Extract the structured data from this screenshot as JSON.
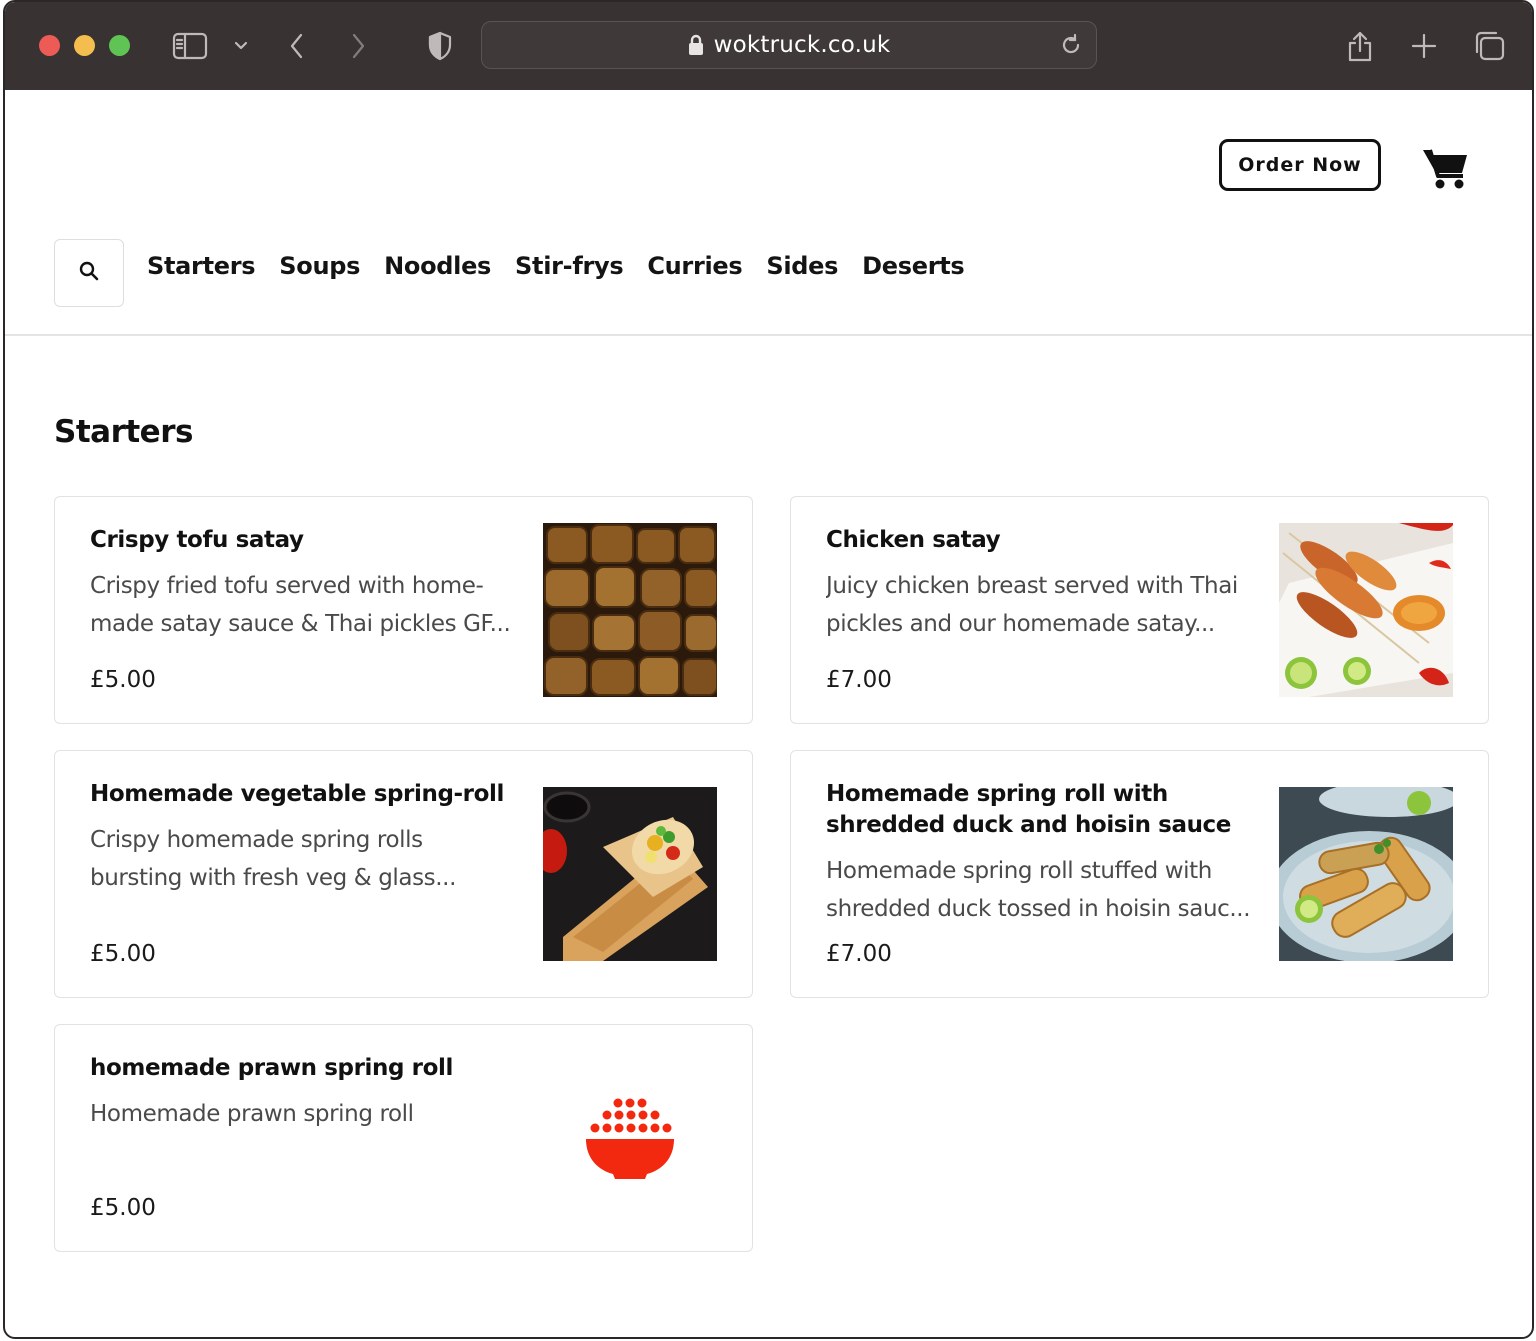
{
  "browser": {
    "url": "woktruck.co.uk"
  },
  "header": {
    "order_button_label": "Order Now",
    "cart_icon": "shopping-cart-icon"
  },
  "nav": {
    "search_icon": "search-icon",
    "items": [
      "Starters",
      "Soups",
      "Noodles",
      "Stir-frys",
      "Curries",
      "Sides",
      "Deserts"
    ]
  },
  "section": {
    "title": "Starters"
  },
  "items": [
    {
      "title": "Crispy tofu satay",
      "description": "Crispy fried tofu served with home-made satay sauce & Thai pickles GF...",
      "price": "£5.00"
    },
    {
      "title": "Chicken satay",
      "description": "Juicy chicken breast served with Thai pickles and our homemade satay...",
      "price": "£7.00"
    },
    {
      "title": "Homemade vegetable spring-roll",
      "description": "Crispy homemade spring rolls bursting with fresh veg & glass...",
      "price": "£5.00"
    },
    {
      "title": "Homemade spring roll with shredded duck and hoisin sauce",
      "description": "Homemade spring roll stuffed with shredded duck tossed in hoisin sauc...",
      "price": "£7.00"
    },
    {
      "title": "homemade prawn spring roll",
      "description": "Homemade prawn spring roll",
      "price": "£5.00"
    }
  ],
  "colors": {
    "chrome_bg": "#383232",
    "placeholder_red": "#f2280f"
  }
}
